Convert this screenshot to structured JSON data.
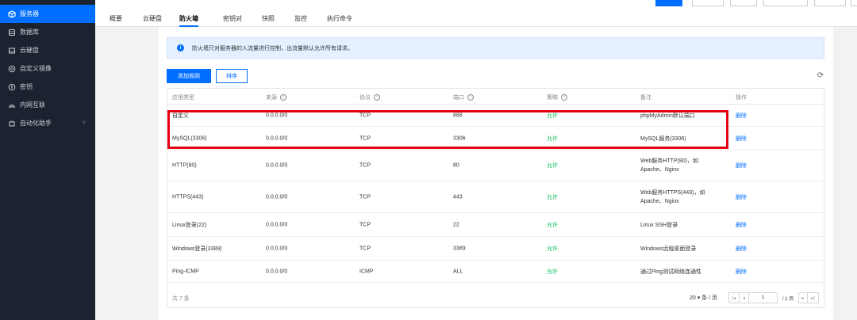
{
  "sidebar": {
    "items": [
      {
        "label": "服务器",
        "icon": "server-icon",
        "active": true
      },
      {
        "label": "数据库",
        "icon": "database-icon"
      },
      {
        "label": "云硬盘",
        "icon": "disk-icon"
      },
      {
        "label": "自定义镜像",
        "icon": "image-icon"
      },
      {
        "label": "密钥",
        "icon": "key-icon"
      },
      {
        "label": "内网互联",
        "icon": "network-icon"
      },
      {
        "label": "自动化助手",
        "icon": "automation-icon",
        "chevron": "˅"
      }
    ]
  },
  "tabs": [
    "概要",
    "云硬盘",
    "防火墙",
    "密钥对",
    "快照",
    "监控",
    "执行命令"
  ],
  "active_tab": "防火墙",
  "notice": {
    "icon": "i",
    "text": "防火墙只对服务器的入流量进行控制，出流量默认允许所有请求。"
  },
  "actions": {
    "add_rule": "添加规则",
    "sort": "排序",
    "refresh_icon": "⟳"
  },
  "table": {
    "headers": [
      "应用类型",
      "来源",
      "协议",
      "端口",
      "策略",
      "备注",
      "操作"
    ],
    "header_help": "i",
    "rows": [
      {
        "type": "自定义",
        "source": "0.0.0.0/0",
        "protocol": "TCP",
        "port": "888",
        "policy": "允许",
        "note": "phpMyAdmin默认端口",
        "op": "删除"
      },
      {
        "type": "MySQL(3306)",
        "source": "0.0.0.0/0",
        "protocol": "TCP",
        "port": "3306",
        "policy": "允许",
        "note": "MySQL服务(3306)",
        "op": "删除"
      },
      {
        "type": "HTTP(80)",
        "source": "0.0.0.0/0",
        "protocol": "TCP",
        "port": "80",
        "policy": "允许",
        "note": "Web服务HTTP(80)，如Apache、Nginx",
        "op": "删除"
      },
      {
        "type": "HTTPS(443)",
        "source": "0.0.0.0/0",
        "protocol": "TCP",
        "port": "443",
        "policy": "允许",
        "note": "Web服务HTTPS(443)，如Apache、Nginx",
        "op": "删除"
      },
      {
        "type": "Linux登录(22)",
        "source": "0.0.0.0/0",
        "protocol": "TCP",
        "port": "22",
        "policy": "允许",
        "note": "Linux SSH登录",
        "op": "删除"
      },
      {
        "type": "Windows登录(3389)",
        "source": "0.0.0.0/0",
        "protocol": "TCP",
        "port": "3389",
        "policy": "允许",
        "note": "Windows远程桌面登录",
        "op": "删除"
      },
      {
        "type": "Ping-ICMP",
        "source": "0.0.0.0/0",
        "protocol": "ICMP",
        "port": "ALL",
        "policy": "允许",
        "note": "通过Ping测试网络连通性",
        "op": "删除"
      }
    ],
    "total": "共 7 条",
    "page_size": "20 ▾ 条 / 页",
    "page_input": "1",
    "page_total": "/ 1 页",
    "pager_first": "|◂",
    "pager_prev": "◂",
    "pager_next": "▸",
    "pager_last": "▸|"
  },
  "colors": {
    "accent": "#006eff",
    "sidebar_bg": "#1b2331",
    "allow": "#0abf5b",
    "highlight": "#e60012"
  }
}
